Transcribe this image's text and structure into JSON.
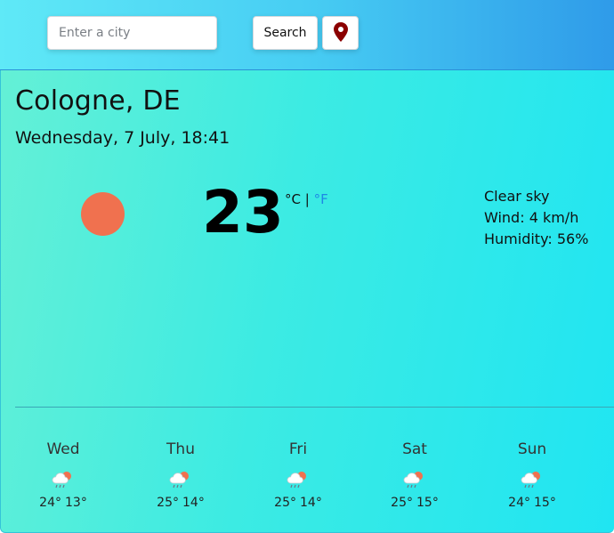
{
  "search": {
    "placeholder": "Enter a city",
    "value": "",
    "button_label": "Search"
  },
  "location_button": {
    "icon": "map-pin-icon",
    "color": "#8b0000"
  },
  "current": {
    "city": "Cologne, DE",
    "datetime": "Wednesday, 7 July, 18:41",
    "icon": "sun-icon",
    "icon_color": "#f0714f",
    "temperature": "23",
    "unit_c": "°C",
    "unit_sep": " | ",
    "unit_f": "°F",
    "description": "Clear sky",
    "wind": "Wind: 4 km/h",
    "humidity": "Humidity: 56%"
  },
  "forecast": [
    {
      "day": "Wed",
      "max": "24°",
      "min": "13°",
      "icon": "rain-cloud-sun-icon"
    },
    {
      "day": "Thu",
      "max": "25°",
      "min": "14°",
      "icon": "rain-cloud-sun-icon"
    },
    {
      "day": "Fri",
      "max": "25°",
      "min": "14°",
      "icon": "rain-cloud-sun-icon"
    },
    {
      "day": "Sat",
      "max": "25°",
      "min": "15°",
      "icon": "rain-cloud-sun-icon"
    },
    {
      "day": "Sun",
      "max": "24°",
      "min": "15°",
      "icon": "rain-cloud-sun-icon"
    }
  ],
  "colors": {
    "accent_f": "#1e88e5",
    "top_bar_start": "#5fe9f7",
    "top_bar_end": "#2f9be9",
    "card_start": "#64f0d6",
    "card_end": "#20e5f2"
  }
}
